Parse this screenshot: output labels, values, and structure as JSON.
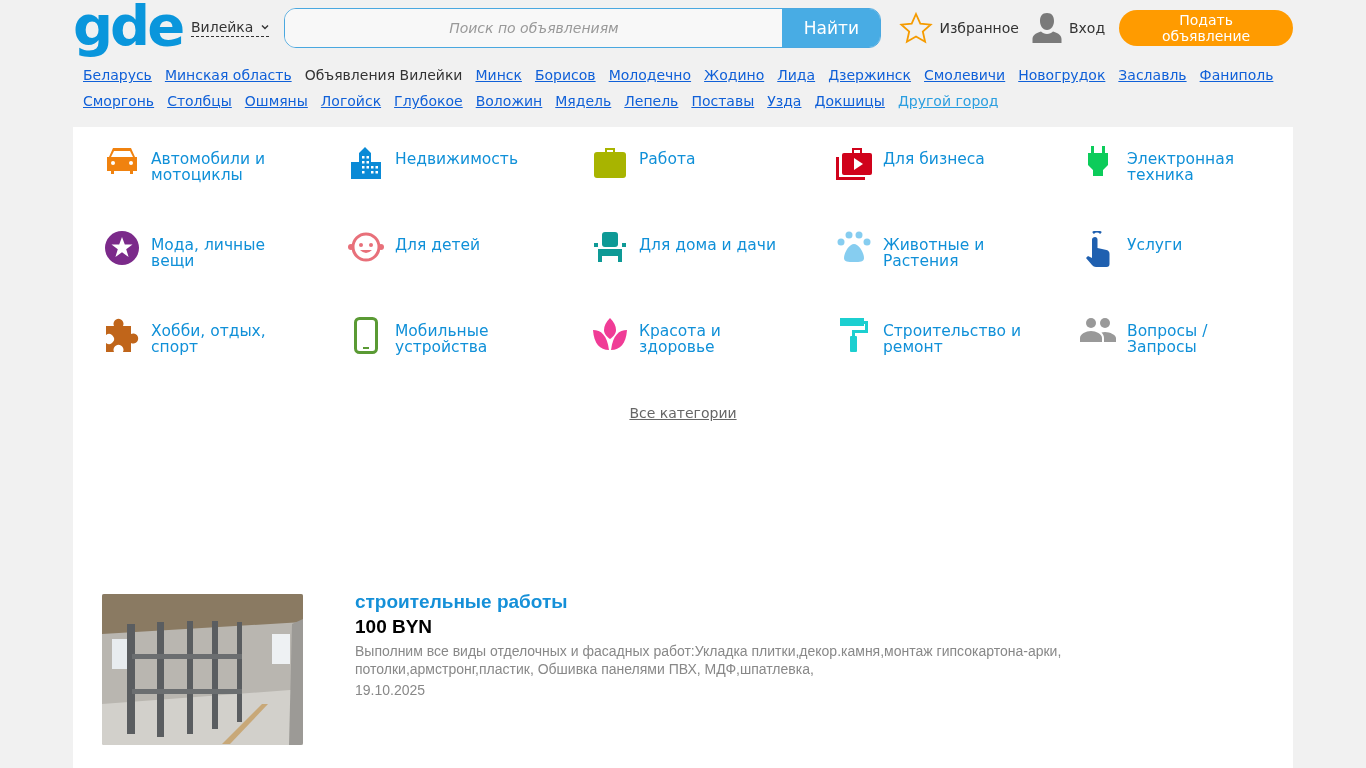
{
  "header": {
    "logo": "gde",
    "city": "Вилейка",
    "search": {
      "placeholder": "Поиск по объявлениям",
      "button": "Найти"
    },
    "favorites": "Избранное",
    "login": "Вход",
    "post_button": "Подать объявление"
  },
  "location_rows": [
    [
      {
        "label": "Беларусь",
        "kind": "link"
      },
      {
        "label": "Минская область",
        "kind": "link"
      },
      {
        "label": "Объявления Вилейки",
        "kind": "current"
      },
      {
        "label": "Минск",
        "kind": "link"
      },
      {
        "label": "Борисов",
        "kind": "link"
      },
      {
        "label": "Молодечно",
        "kind": "link"
      },
      {
        "label": "Жодино",
        "kind": "link"
      },
      {
        "label": "Лида",
        "kind": "link"
      },
      {
        "label": "Дзержинск",
        "kind": "link"
      },
      {
        "label": "Смолевичи",
        "kind": "link"
      },
      {
        "label": "Новогрудок",
        "kind": "link"
      },
      {
        "label": "Заславль",
        "kind": "link"
      },
      {
        "label": "Фаниполь",
        "kind": "link"
      }
    ],
    [
      {
        "label": "Сморгонь",
        "kind": "link"
      },
      {
        "label": "Столбцы",
        "kind": "link"
      },
      {
        "label": "Ошмяны",
        "kind": "link"
      },
      {
        "label": "Логойск",
        "kind": "link"
      },
      {
        "label": "Глубокое",
        "kind": "link"
      },
      {
        "label": "Воложин",
        "kind": "link"
      },
      {
        "label": "Мядель",
        "kind": "link"
      },
      {
        "label": "Лепель",
        "kind": "link"
      },
      {
        "label": "Поставы",
        "kind": "link"
      },
      {
        "label": "Узда",
        "kind": "link"
      },
      {
        "label": "Докшицы",
        "kind": "link"
      },
      {
        "label": "Другой город",
        "kind": "other"
      }
    ]
  ],
  "categories": [
    {
      "label": "Автомобили и мотоциклы",
      "kind": "car",
      "color": "#f0820f"
    },
    {
      "label": "Недвижимость",
      "kind": "building",
      "color": "#0a8ad6"
    },
    {
      "label": "Работа",
      "kind": "briefcase",
      "color": "#a8b400"
    },
    {
      "label": "Для бизнеса",
      "kind": "business",
      "color": "#d0021b"
    },
    {
      "label": "Электронная техника",
      "kind": "plug",
      "color": "#0ccc5a"
    },
    {
      "label": "Мода, личные вещи",
      "kind": "star",
      "color": "#7b2a8a"
    },
    {
      "label": "Для детей",
      "kind": "face",
      "color": "#e8707a"
    },
    {
      "label": "Для дома и дачи",
      "kind": "chair",
      "color": "#0e9a96"
    },
    {
      "label": "Животные и Растения",
      "kind": "paw",
      "color": "#86cdf0"
    },
    {
      "label": "Услуги",
      "kind": "hand",
      "color": "#1f60b0"
    },
    {
      "label": "Хобби, отдых, спорт",
      "kind": "puzzle",
      "color": "#c0651a"
    },
    {
      "label": "Мобильные устройства",
      "kind": "phone",
      "color": "#5a9a34"
    },
    {
      "label": "Красота и здоровье",
      "kind": "lotus",
      "color": "#f03c96"
    },
    {
      "label": "Строительство и ремонт",
      "kind": "roller",
      "color": "#1ccfd0"
    },
    {
      "label": "Вопросы / Запросы",
      "kind": "people",
      "color": "#999999"
    }
  ],
  "all_categories": "Все категории",
  "listings": [
    {
      "title": "строительные работы",
      "price": "100 BYN",
      "description": "Выполним все виды отделочных и фасадных работ:Укладка плитки,декор.камня,монтаж гипсокартона-арки, потолки,армстронг,пластик, Обшивка панелями ПВХ, МДФ,шпатлевка,",
      "date": "19.10.2025"
    }
  ]
}
